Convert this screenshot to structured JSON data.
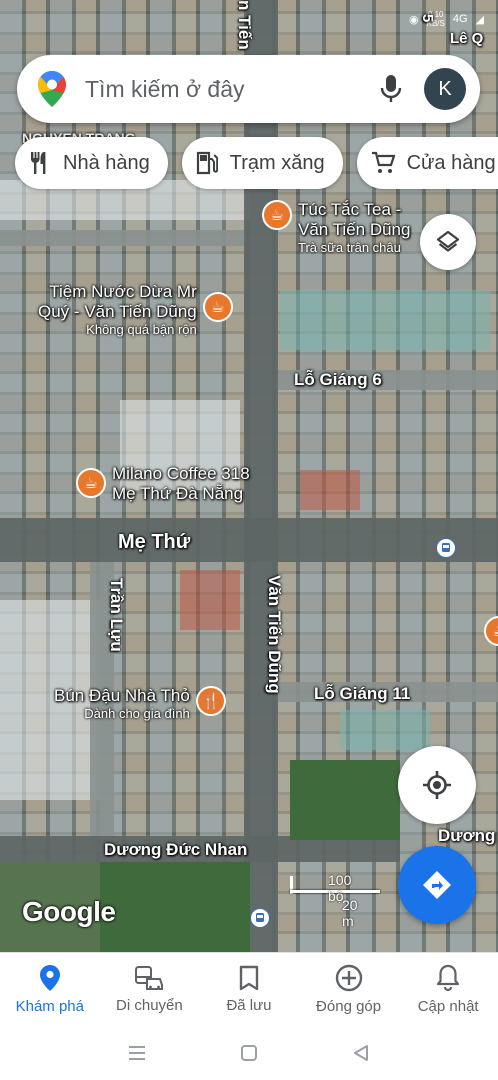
{
  "status_bar": {
    "net_speed": "0.10",
    "net_unit": "KB/S",
    "signal": "4G",
    "lte": "LTE"
  },
  "search": {
    "placeholder": "Tìm kiếm ở đây",
    "avatar_initial": "K"
  },
  "chips": [
    {
      "label": "Nhà hàng",
      "icon": "restaurant-icon"
    },
    {
      "label": "Trạm xăng",
      "icon": "gas-station-icon"
    },
    {
      "label": "Cửa hàng t",
      "icon": "shopping-cart-icon"
    }
  ],
  "streets": {
    "van_tien_dung_top": "n Tiến",
    "le_top": "Lê Q",
    "top_left": "NGUYEN TRANG",
    "top_left2": "N",
    "top_left3": "P.",
    "lo_giang_6": "Lỗ Giáng 6",
    "me_thu": "Mẹ Thứ",
    "tran_luu": "Trần Lựu",
    "van_tien_dung": "Văn Tiến Dũng",
    "lo_giang_11": "Lỗ Giáng 11",
    "duong_duc_nhan": "Dương Đức Nhan",
    "duong_right": "Dương",
    "right_5": "5"
  },
  "pois": [
    {
      "name_line1": "Túc Tắc Tea -",
      "name_line2": "Văn Tiến Dũng",
      "subtitle": "Trà sữa trân châu",
      "icon": "cafe-icon"
    },
    {
      "name_line1": "Tiệm Nước Dừa Mr",
      "name_line2": "Quý - Văn Tiến Dũng",
      "subtitle": "Không quá bận rộn",
      "icon": "cafe-icon"
    },
    {
      "name_line1": "Milano Coffee 318",
      "name_line2": "Mẹ Thứ Đà Nẵng",
      "subtitle": "",
      "icon": "cafe-icon"
    },
    {
      "name_line1": "Bún Đậu Nhà Thỏ",
      "name_line2": "",
      "subtitle": "Dành cho gia đình",
      "icon": "restaurant-icon"
    }
  ],
  "map": {
    "logo": "Google",
    "scale_imperial": "100 bộ",
    "scale_metric": "20 m"
  },
  "bottom_nav": [
    {
      "label": "Khám phá",
      "icon": "explore-pin-icon",
      "active": true
    },
    {
      "label": "Di chuyển",
      "icon": "commute-icon",
      "active": false
    },
    {
      "label": "Đã lưu",
      "icon": "bookmark-icon",
      "active": false
    },
    {
      "label": "Đóng góp",
      "icon": "add-circle-icon",
      "active": false
    },
    {
      "label": "Cập nhật",
      "icon": "bell-icon",
      "active": false
    }
  ],
  "colors": {
    "accent": "#1a73e8",
    "poi": "#e8772e",
    "text": "#3c4043"
  }
}
